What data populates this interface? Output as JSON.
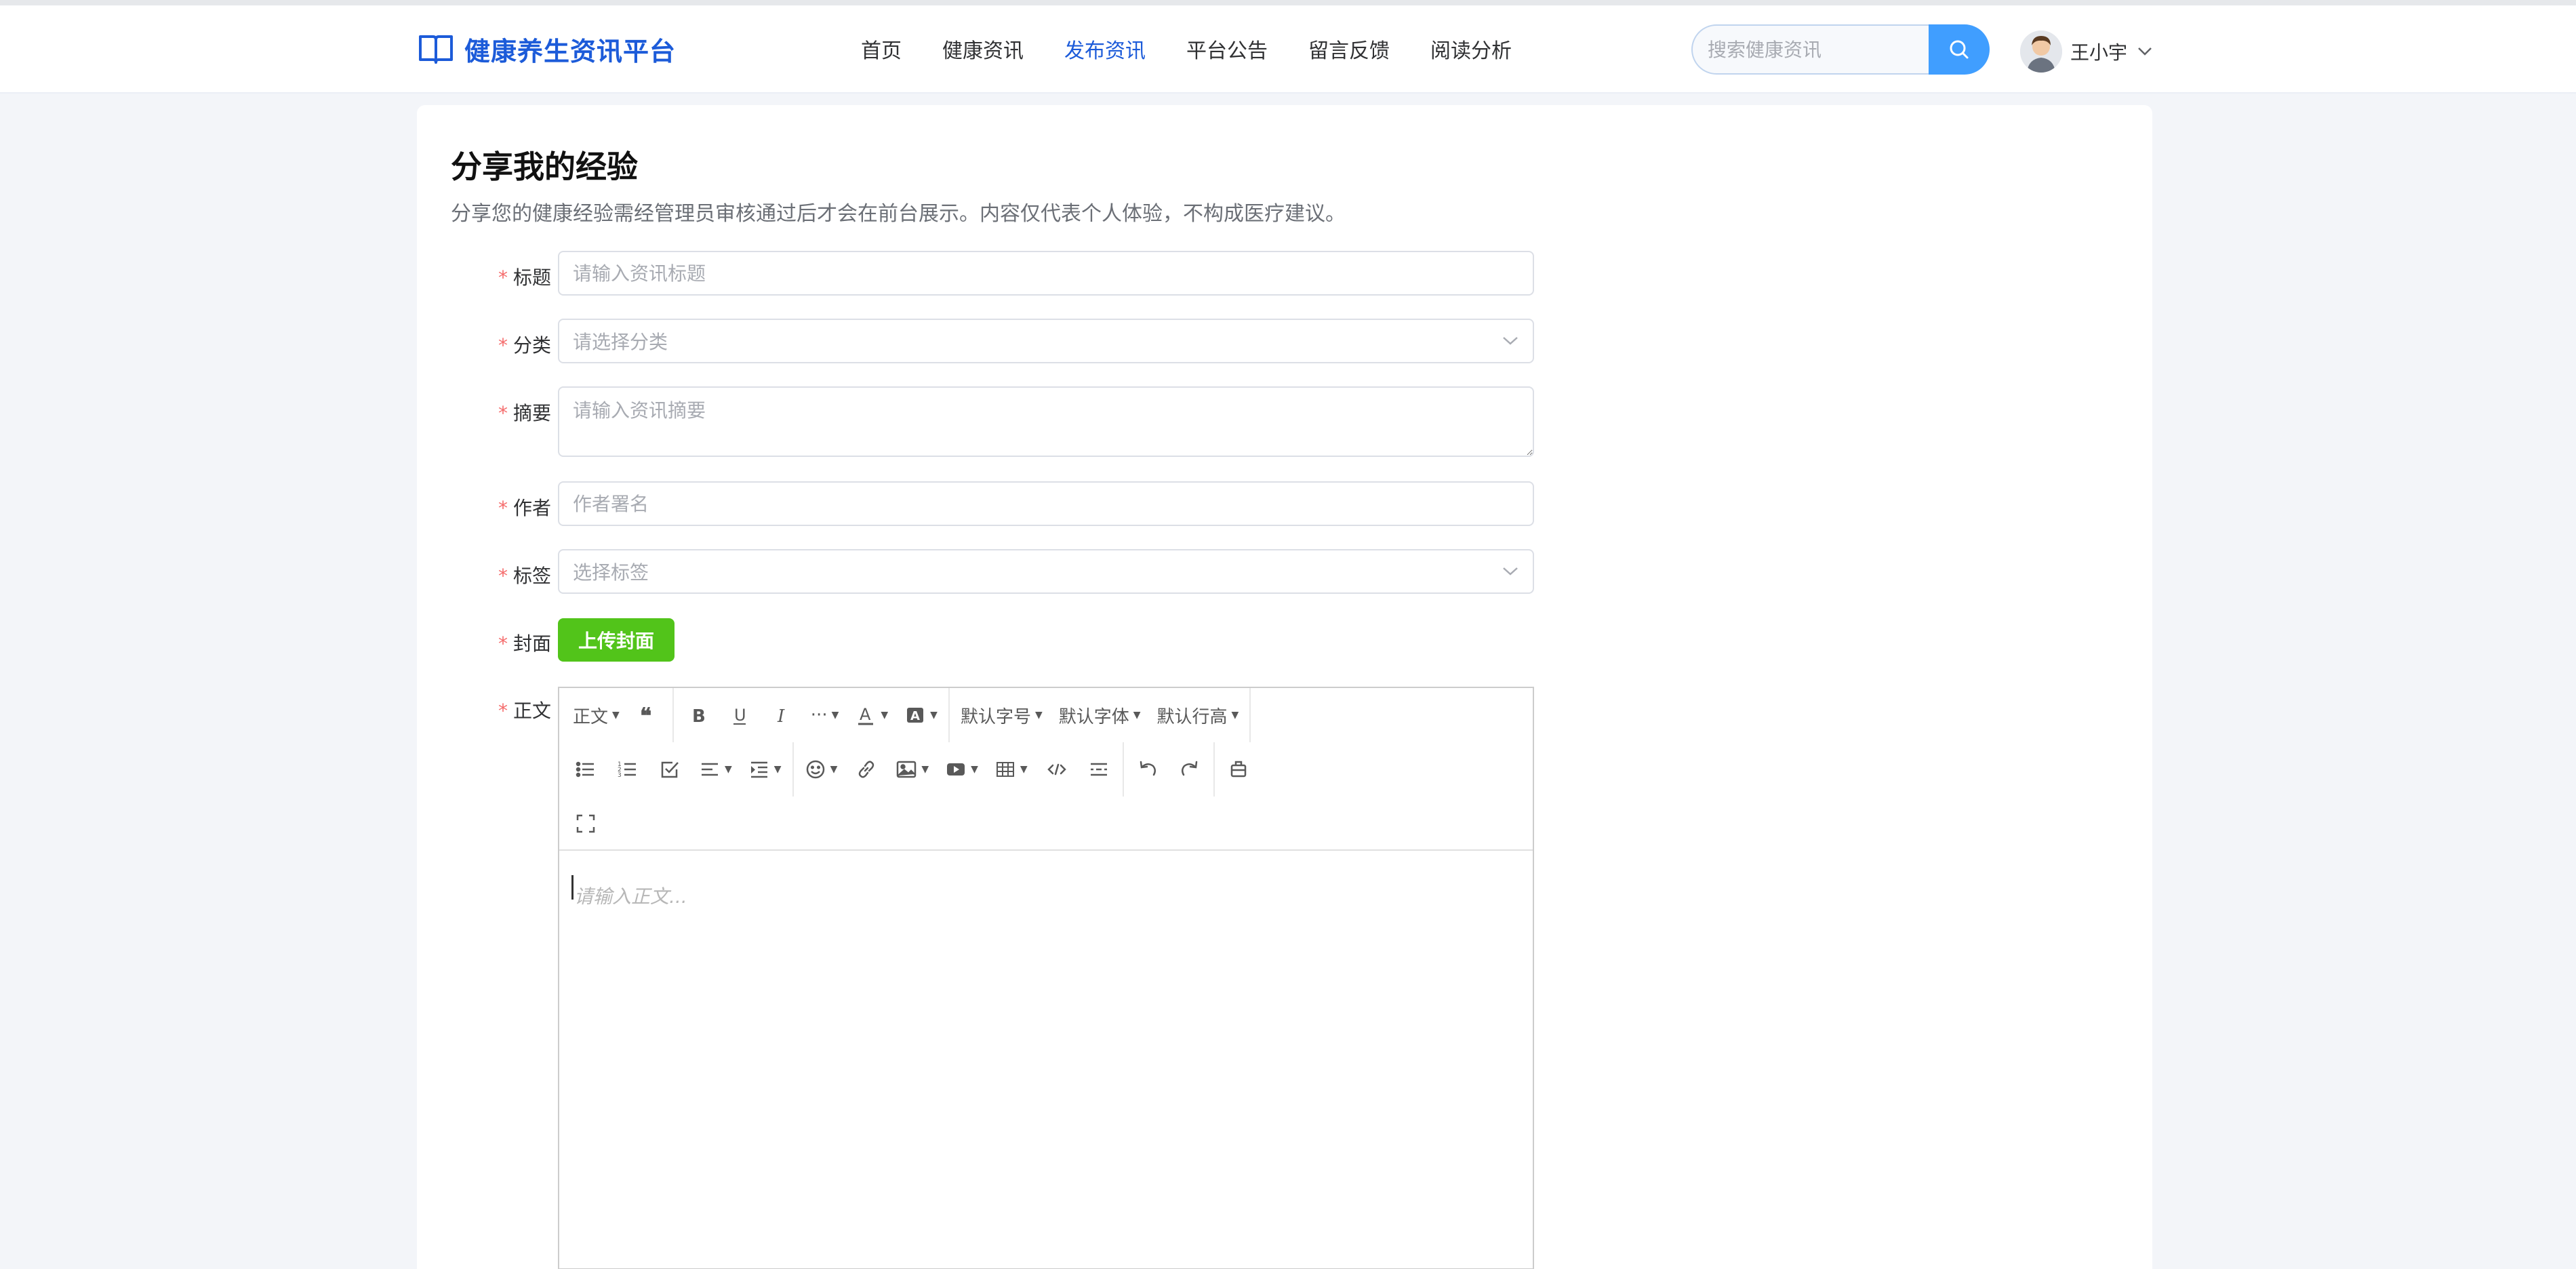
{
  "header": {
    "logo_text": "健康养生资讯平台",
    "nav": [
      {
        "label": "首页",
        "active": false
      },
      {
        "label": "健康资讯",
        "active": false
      },
      {
        "label": "发布资讯",
        "active": true
      },
      {
        "label": "平台公告",
        "active": false
      },
      {
        "label": "留言反馈",
        "active": false
      },
      {
        "label": "阅读分析",
        "active": false
      }
    ],
    "search_placeholder": "搜索健康资讯",
    "user_name": "王小宇"
  },
  "page": {
    "title": "分享我的经验",
    "description": "分享您的健康经验需经管理员审核通过后才会在前台展示。内容仅代表个人体验，不构成医疗建议。"
  },
  "form": {
    "title": {
      "label": "标题",
      "placeholder": "请输入资讯标题",
      "value": ""
    },
    "category": {
      "label": "分类",
      "placeholder": "请选择分类"
    },
    "summary": {
      "label": "摘要",
      "placeholder": "请输入资讯摘要",
      "value": ""
    },
    "author": {
      "label": "作者",
      "placeholder": "作者署名",
      "value": ""
    },
    "tags": {
      "label": "标签",
      "placeholder": "选择标签"
    },
    "cover": {
      "label": "封面",
      "button": "上传封面"
    },
    "content": {
      "label": "正文",
      "placeholder": "请输入正文..."
    }
  },
  "editor_toolbar": {
    "paragraph": "正文",
    "more": "···",
    "font_size": "默认字号",
    "font_family": "默认字体",
    "line_height": "默认行高"
  },
  "colors": {
    "brand": "#1c5bd9",
    "search_button": "#409eff",
    "upload_button": "#52c41a",
    "required_star": "#f56c6c"
  }
}
